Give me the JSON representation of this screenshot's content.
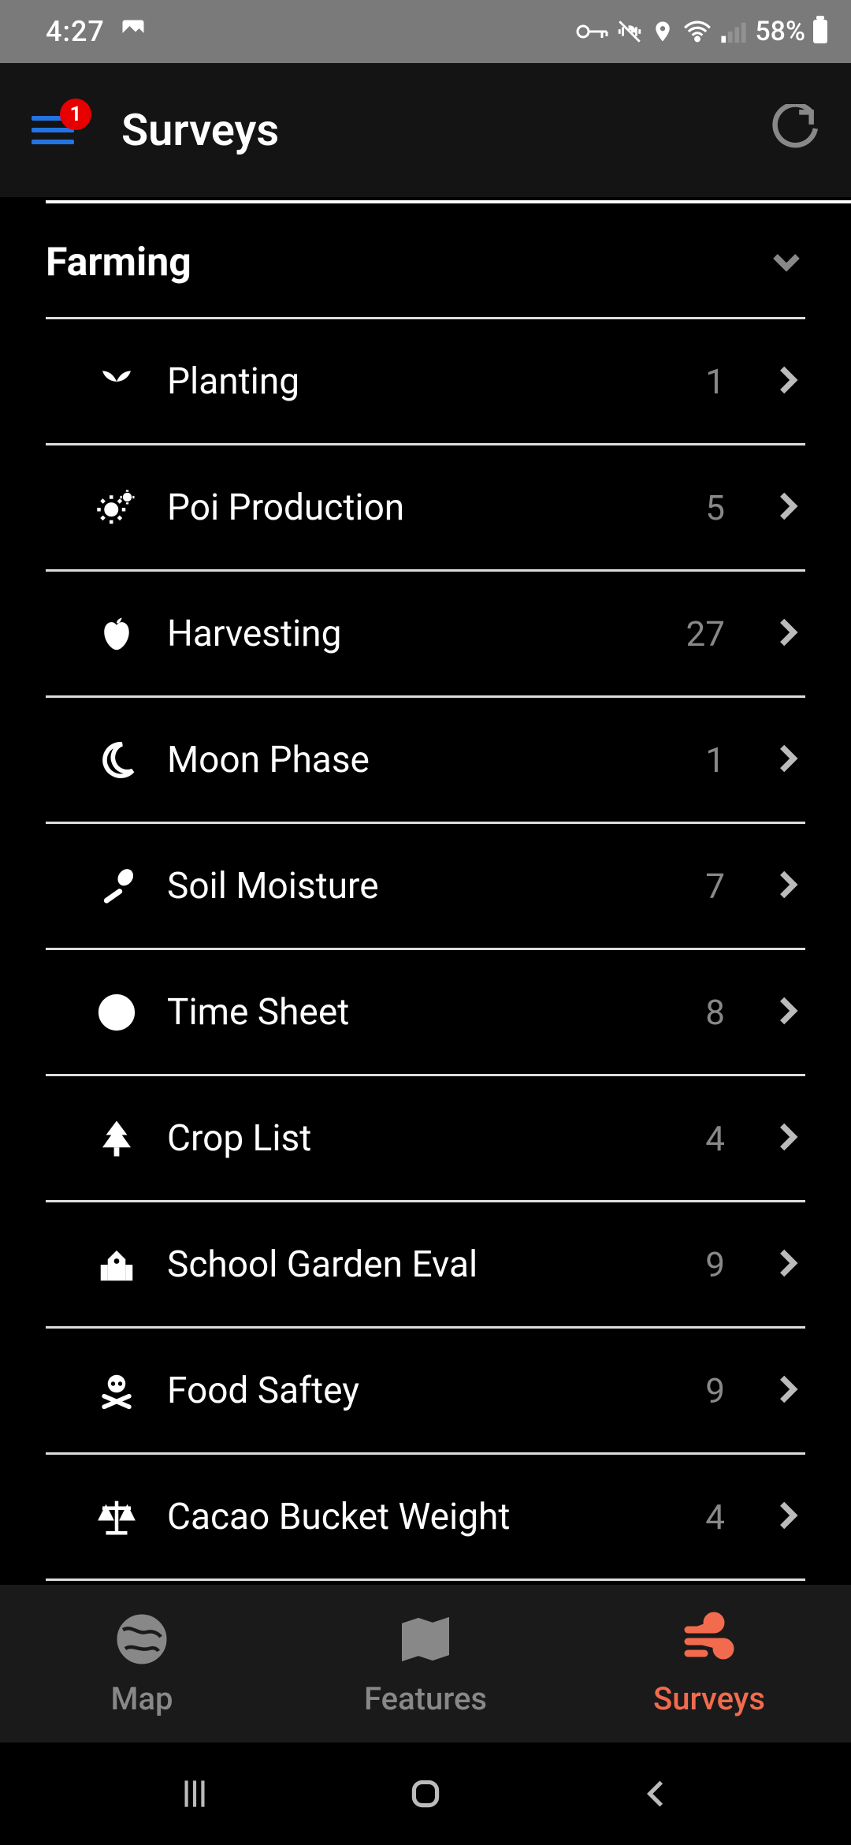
{
  "status": {
    "time": "4:27",
    "battery": "58%"
  },
  "header": {
    "title": "Surveys",
    "badge": "1"
  },
  "section": {
    "title": "Farming",
    "items": [
      {
        "icon": "sprout-icon",
        "label": "Planting",
        "count": "1"
      },
      {
        "icon": "gears-icon",
        "label": "Poi Production",
        "count": "5"
      },
      {
        "icon": "apple-icon",
        "label": "Harvesting",
        "count": "27"
      },
      {
        "icon": "moon-icon",
        "label": "Moon Phase",
        "count": "1"
      },
      {
        "icon": "spoon-icon",
        "label": "Soil Moisture",
        "count": "7"
      },
      {
        "icon": "clock-icon",
        "label": "Time Sheet",
        "count": "8"
      },
      {
        "icon": "tree-icon",
        "label": "Crop List",
        "count": "4"
      },
      {
        "icon": "school-icon",
        "label": "School Garden Eval",
        "count": "9"
      },
      {
        "icon": "skull-icon",
        "label": "Food Saftey",
        "count": "9"
      },
      {
        "icon": "scale-icon",
        "label": "Cacao Bucket Weight",
        "count": "4"
      }
    ]
  },
  "nav": {
    "items": [
      {
        "label": "Map",
        "active": false
      },
      {
        "label": "Features",
        "active": false
      },
      {
        "label": "Surveys",
        "active": true
      }
    ]
  }
}
